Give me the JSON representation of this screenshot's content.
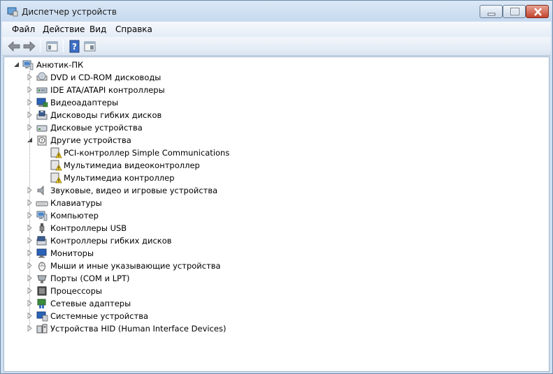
{
  "window": {
    "title": "Диспетчер устройств"
  },
  "menu": [
    "Файл",
    "Действие",
    "Вид",
    "Справка"
  ],
  "tree": {
    "root": "Анютик-ПК",
    "categories": [
      {
        "label": "DVD и CD-ROM дисководы",
        "icon": "dvd-drive-icon"
      },
      {
        "label": "IDE ATA/ATAPI контроллеры",
        "icon": "ide-controller-icon"
      },
      {
        "label": "Видеоадаптеры",
        "icon": "display-adapter-icon"
      },
      {
        "label": "Дисководы гибких дисков",
        "icon": "floppy-drive-icon"
      },
      {
        "label": "Дисковые устройства",
        "icon": "disk-drive-icon"
      },
      {
        "label": "Другие устройства",
        "icon": "unknown-device-icon",
        "expanded": true,
        "children": [
          {
            "label": "PCI-контроллер Simple Communications",
            "icon": "warning-device-icon"
          },
          {
            "label": "Мультимедиа видеоконтроллер",
            "icon": "warning-device-icon"
          },
          {
            "label": "Мультимедиа контроллер",
            "icon": "warning-device-icon"
          }
        ]
      },
      {
        "label": "Звуковые, видео и игровые устройства",
        "icon": "speaker-icon"
      },
      {
        "label": "Клавиатуры",
        "icon": "keyboard-icon"
      },
      {
        "label": "Компьютер",
        "icon": "computer-icon"
      },
      {
        "label": "Контроллеры USB",
        "icon": "usb-icon"
      },
      {
        "label": "Контроллеры гибких дисков",
        "icon": "floppy-controller-icon"
      },
      {
        "label": "Мониторы",
        "icon": "monitor-icon"
      },
      {
        "label": "Мыши и иные указывающие устройства",
        "icon": "mouse-icon"
      },
      {
        "label": "Порты (COM и LPT)",
        "icon": "port-icon"
      },
      {
        "label": "Процессоры",
        "icon": "processor-icon"
      },
      {
        "label": "Сетевые адаптеры",
        "icon": "network-adapter-icon"
      },
      {
        "label": "Системные устройства",
        "icon": "system-device-icon"
      },
      {
        "label": "Устройства HID (Human Interface Devices)",
        "icon": "hid-icon"
      }
    ]
  }
}
